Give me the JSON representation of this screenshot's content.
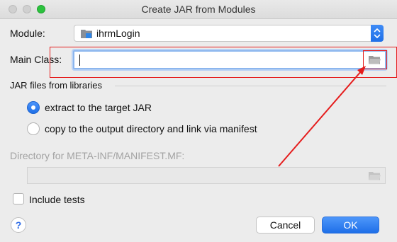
{
  "window": {
    "title": "Create JAR from Modules"
  },
  "form": {
    "module_label": "Module:",
    "module_value": "ihrmLogin",
    "main_class_label": "Main Class:",
    "main_class_value": "",
    "jar_section_label": "JAR files from libraries",
    "radio_extract_label": "extract to the target JAR",
    "radio_copy_label": "copy to the output directory and link via manifest",
    "selected_option": "extract to the target JAR",
    "manifest_dir_label": "Directory for META-INF/MANIFEST.MF:",
    "manifest_dir_value": "",
    "include_tests_label": "Include tests",
    "include_tests_checked": false
  },
  "buttons": {
    "help": "?",
    "cancel": "Cancel",
    "ok": "OK"
  },
  "icons": {
    "module": "module-folder-icon",
    "browse": "folder-icon",
    "stepper": "up-down-chevron-icon"
  },
  "colors": {
    "accent": "#1f6fe8",
    "annotation": "#e51c1c",
    "window_bg": "#ececec"
  }
}
